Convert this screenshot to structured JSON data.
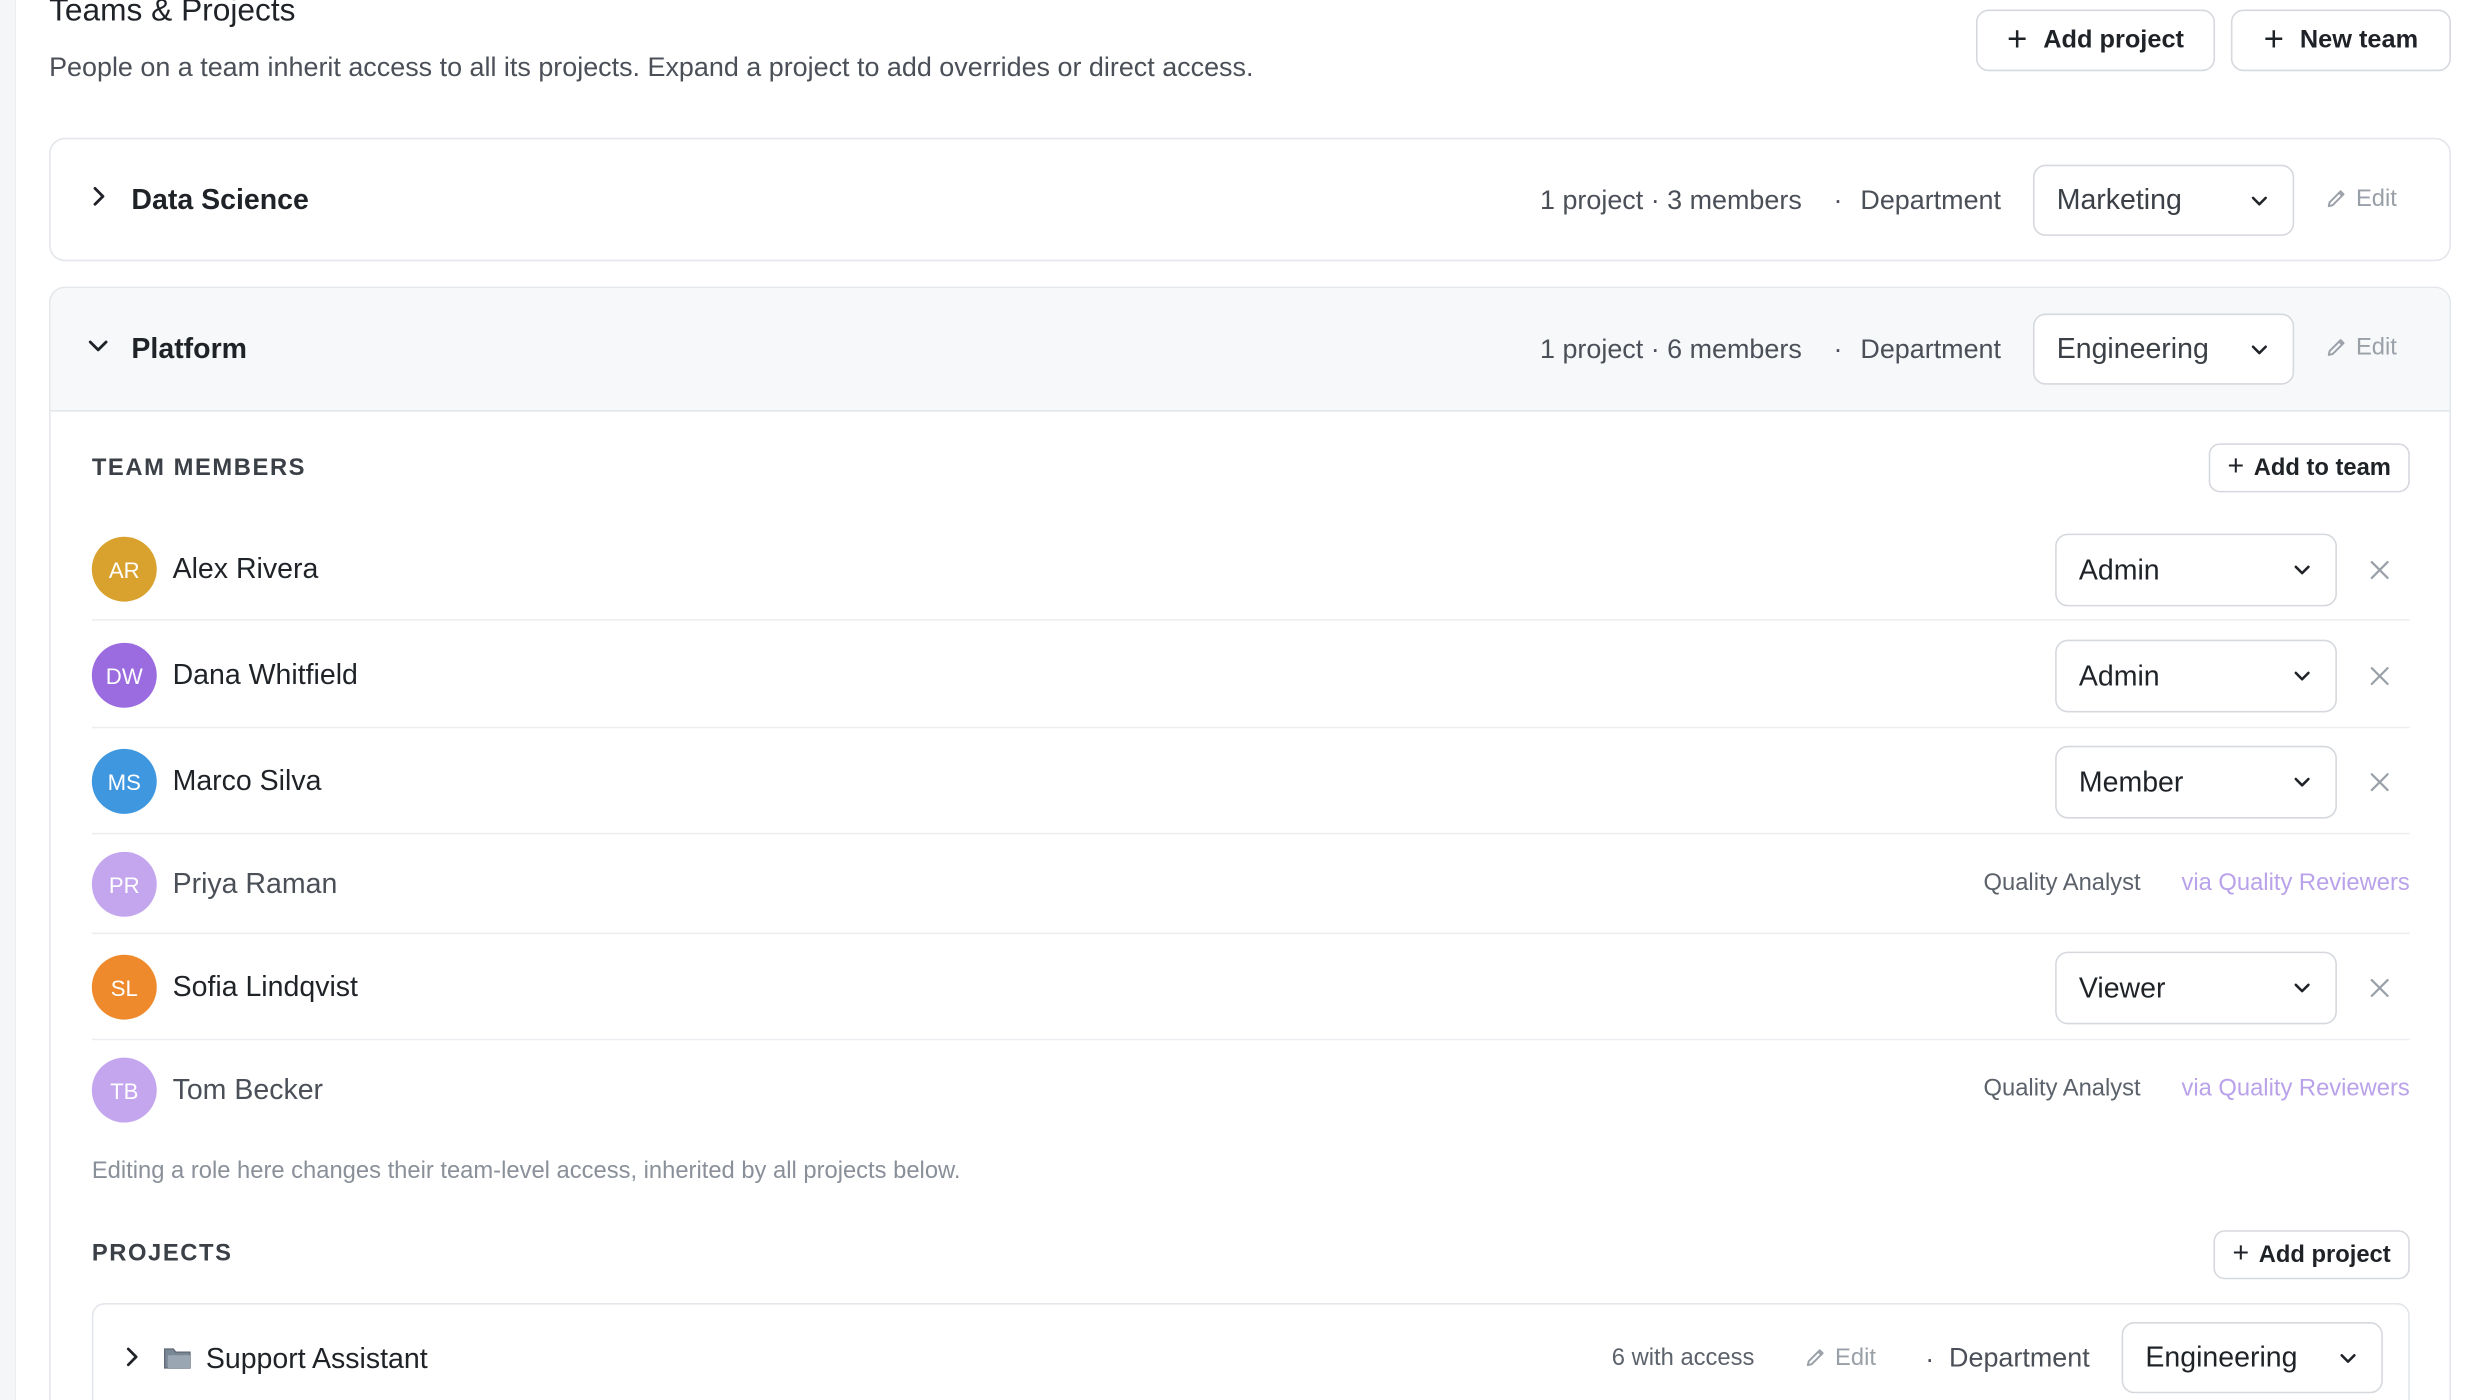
{
  "header": {
    "title": "Teams & Projects",
    "subtitle": "People on a team inherit access to all its projects. Expand a project to add overrides or direct access.",
    "add_project_label": "Add project",
    "new_team_label": "New team"
  },
  "teams": [
    {
      "name": "Data Science",
      "expanded": false,
      "stats": "1 project · 3 members",
      "department_label": "Department",
      "department": "Marketing",
      "edit_label": "Edit"
    },
    {
      "name": "Platform",
      "expanded": true,
      "stats": "1 project · 6 members",
      "department_label": "Department",
      "department": "Engineering",
      "edit_label": "Edit",
      "members_title": "TEAM MEMBERS",
      "add_to_team_label": "Add to team",
      "members": [
        {
          "initials": "AR",
          "name": "Alex Rivera",
          "role": "Admin",
          "avatar_color": "#d9a22e"
        },
        {
          "initials": "DW",
          "name": "Dana Whitfield",
          "role": "Admin",
          "avatar_color": "#9b6be0"
        },
        {
          "initials": "MS",
          "name": "Marco Silva",
          "role": "Member",
          "avatar_color": "#3f97e0"
        },
        {
          "initials": "PR",
          "name": "Priya Raman",
          "inherited_role": "Quality Analyst",
          "via": "via Quality Reviewers",
          "avatar_color": "#c4a6ef"
        },
        {
          "initials": "SL",
          "name": "Sofia Lindqvist",
          "role": "Viewer",
          "avatar_color": "#ee8a2c"
        },
        {
          "initials": "TB",
          "name": "Tom Becker",
          "inherited_role": "Quality Analyst",
          "via": "via Quality Reviewers",
          "avatar_color": "#c4a6ef"
        }
      ],
      "help_text": "Editing a role here changes their team-level access, inherited by all projects below.",
      "projects_title": "PROJECTS",
      "add_project_label": "Add project",
      "projects": [
        {
          "name": "Support Assistant",
          "access": "6 with access",
          "edit_label": "Edit",
          "department_label": "Department",
          "department": "Engineering"
        }
      ]
    }
  ]
}
